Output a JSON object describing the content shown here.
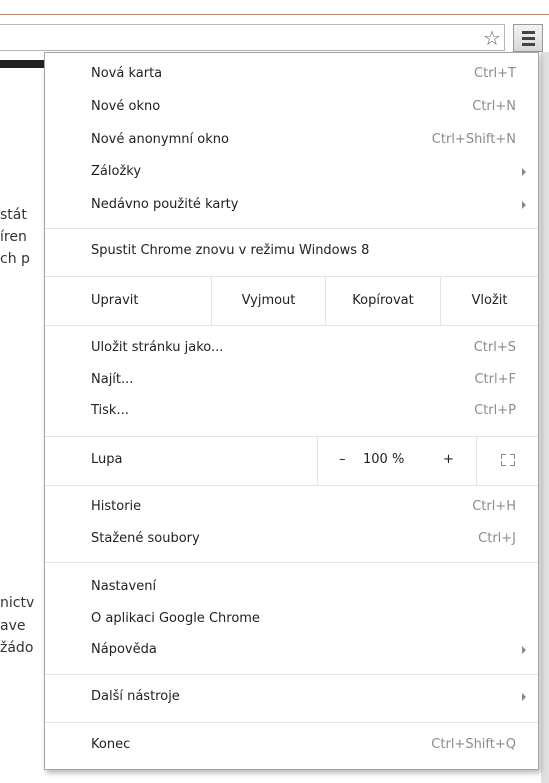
{
  "toolbar": {
    "star_icon": "star-icon",
    "menu_icon": "hamburger-menu-icon"
  },
  "background_page": {
    "lines": [
      "stát",
      "íren",
      "ch p",
      "nictv",
      "ave",
      "žádo"
    ]
  },
  "menu": {
    "group1": [
      {
        "label": "Nová karta",
        "shortcut": "Ctrl+T"
      },
      {
        "label": "Nové okno",
        "shortcut": "Ctrl+N"
      },
      {
        "label": "Nové anonymní okno",
        "shortcut": "Ctrl+Shift+N"
      },
      {
        "label": "Záložky",
        "shortcut": ""
      },
      {
        "label": "Nedávno použité karty",
        "shortcut": ""
      }
    ],
    "relaunch": "Spustit Chrome znovu v režimu Windows 8",
    "edit": {
      "label": "Upravit",
      "cut": "Vyjmout",
      "copy": "Kopírovat",
      "paste": "Vložit"
    },
    "group3": [
      {
        "label": "Uložit stránku jako...",
        "shortcut": "Ctrl+S"
      },
      {
        "label": "Najít...",
        "shortcut": "Ctrl+F"
      },
      {
        "label": "Tisk...",
        "shortcut": "Ctrl+P"
      }
    ],
    "zoom": {
      "label": "Lupa",
      "minus": "–",
      "value": "100 %",
      "plus": "+"
    },
    "group5": [
      {
        "label": "Historie",
        "shortcut": "Ctrl+H"
      },
      {
        "label": "Stažené soubory",
        "shortcut": "Ctrl+J"
      }
    ],
    "group6": [
      {
        "label": "Nastavení"
      },
      {
        "label": "O aplikaci Google Chrome"
      },
      {
        "label": "Nápověda"
      }
    ],
    "more_tools": "Další nástroje",
    "exit": {
      "label": "Konec",
      "shortcut": "Ctrl+Shift+Q"
    }
  }
}
